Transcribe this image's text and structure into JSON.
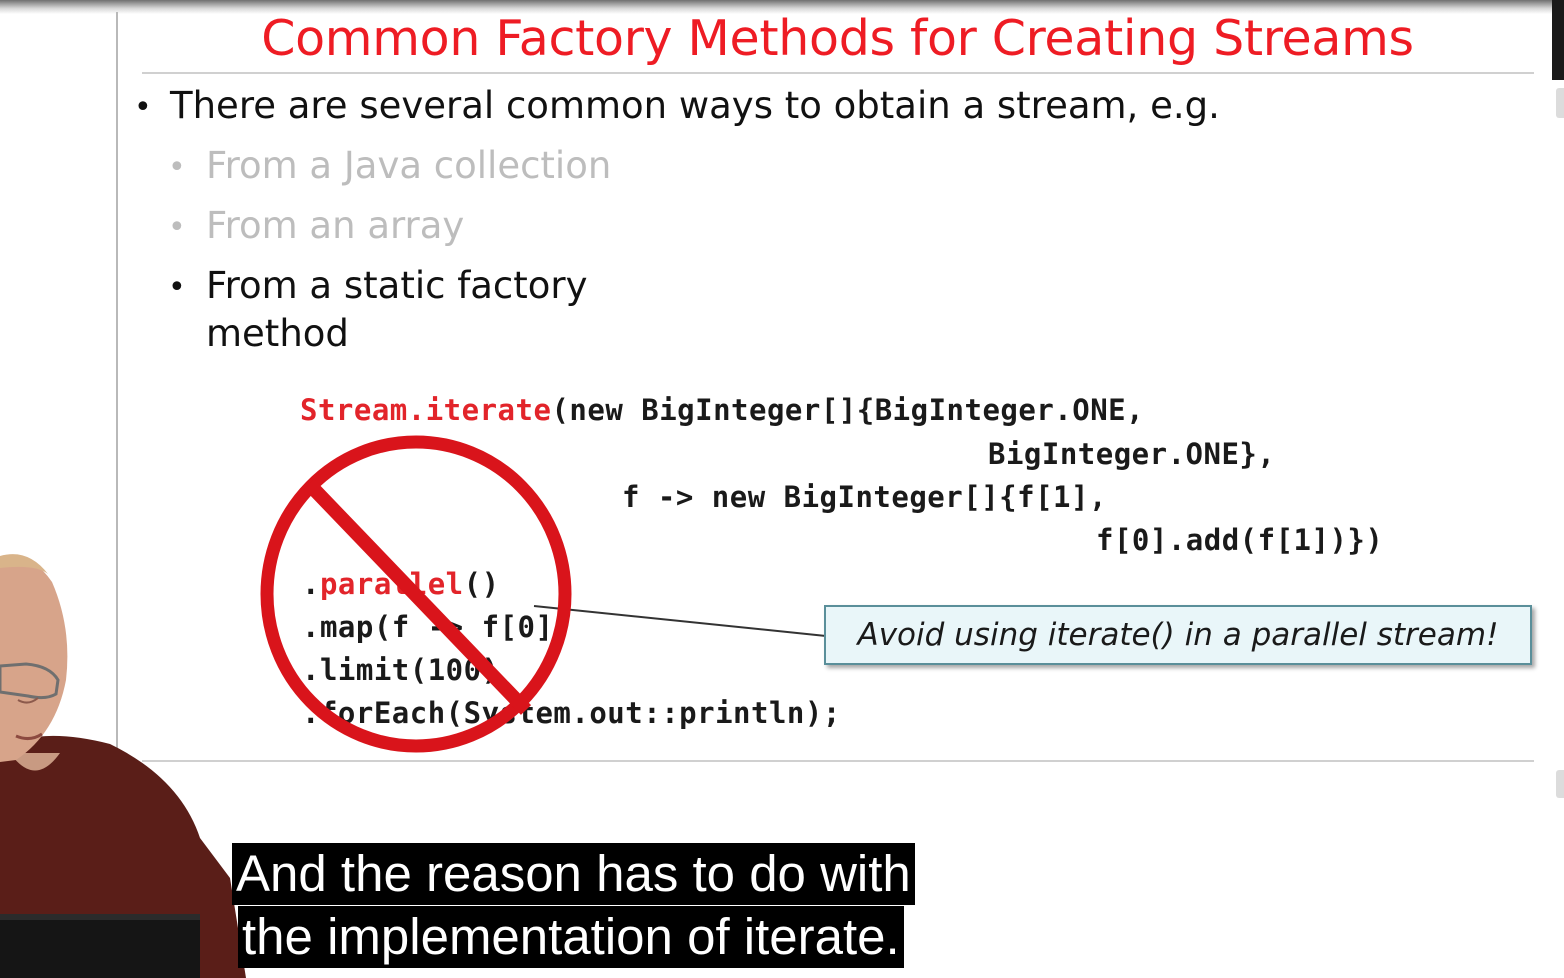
{
  "slide": {
    "title": "Common Factory Methods for Creating Streams",
    "bullets": [
      {
        "text": "There are several common ways to obtain a stream, e.g.",
        "state": "active"
      },
      {
        "text": "From a Java collection",
        "state": "dimmed"
      },
      {
        "text": "From an array",
        "state": "dimmed"
      },
      {
        "text": "From a static factory",
        "text_line2": "method",
        "state": "active"
      }
    ],
    "code": {
      "line1_red": "Stream.iterate",
      "line1_rest": "(new BigInteger[]{BigInteger.ONE,",
      "line2": "BigInteger.ONE},",
      "line3": "f -> new BigInteger[]{f[1],",
      "line4": "f[0].add(f[1])})",
      "line5_prefix": ".",
      "line5_red": "parallel",
      "line5_rest": "()",
      "line6": ".map(f -> f[0])",
      "line7": ".limit(100)",
      "line8": ".forEach(System.out::println);"
    },
    "callout": "Avoid using iterate() in a parallel stream!",
    "prohibition_icon": "no-sign-icon"
  },
  "captions": {
    "line1": "And the reason has to do with",
    "line2": "the implementation of iterate."
  },
  "colors": {
    "title": "#ee1c24",
    "code_highlight": "#e2242a",
    "no_sign": "#d9141b",
    "dimmed_text": "#bdbdbd",
    "callout_bg": "#e9f6f9",
    "callout_border": "#5a8f9a",
    "caption_bg": "#000000",
    "caption_text": "#ffffff"
  }
}
